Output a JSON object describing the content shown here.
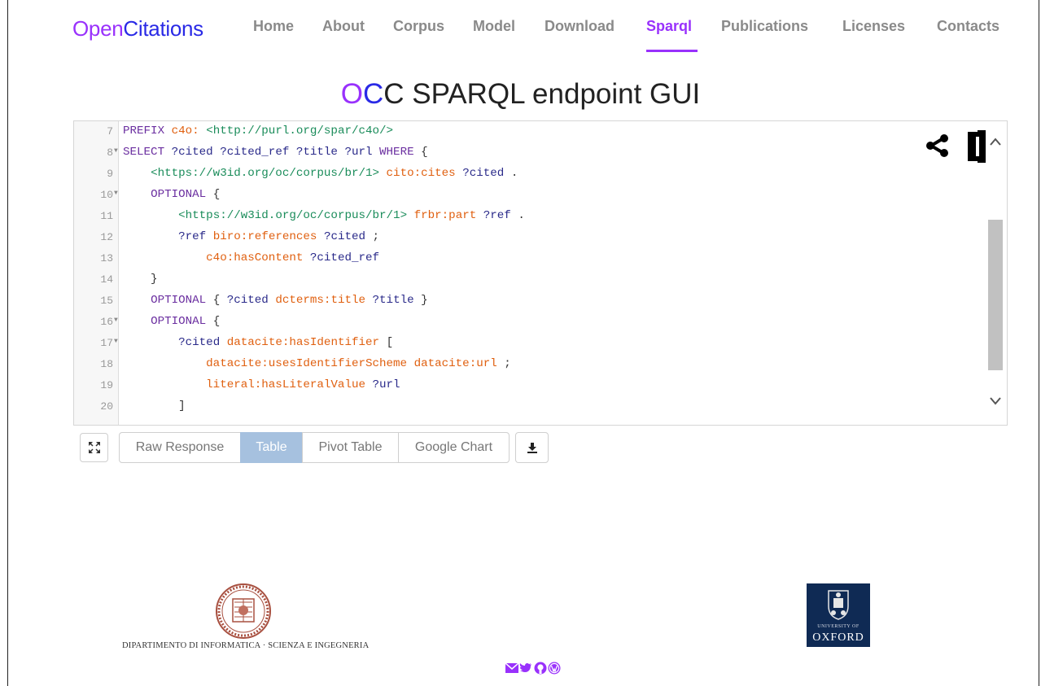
{
  "brand": {
    "part1": "Open",
    "part2": "Citations"
  },
  "nav": {
    "items": [
      {
        "label": "Home"
      },
      {
        "label": "About"
      },
      {
        "label": "Corpus"
      },
      {
        "label": "Model"
      },
      {
        "label": "Download"
      },
      {
        "label": "Sparql",
        "active": true
      },
      {
        "label": "Publications"
      },
      {
        "label": "Licenses"
      },
      {
        "label": "Contacts"
      }
    ]
  },
  "title": {
    "part1": "O",
    "part2": "C",
    "rest": "C SPARQL endpoint GUI"
  },
  "editor": {
    "lines": [
      {
        "n": "7",
        "fold": false,
        "tokens": [
          [
            "kw",
            "PREFIX "
          ],
          [
            "pfx",
            "c4o: "
          ],
          [
            "iri",
            "<http://purl.org/spar/c4o/>"
          ]
        ]
      },
      {
        "n": "8",
        "fold": true,
        "tokens": [
          [
            "kw",
            "SELECT "
          ],
          [
            "var",
            "?cited ?cited_ref ?title ?url "
          ],
          [
            "kw",
            "WHERE "
          ],
          [
            "pn",
            "{"
          ]
        ]
      },
      {
        "n": "9",
        "fold": false,
        "tokens": [
          [
            "pn",
            "    "
          ],
          [
            "iri",
            "<https://w3id.org/oc/corpus/br/1> "
          ],
          [
            "pfx",
            "cito:cites "
          ],
          [
            "var",
            "?cited "
          ],
          [
            "pn",
            "."
          ]
        ]
      },
      {
        "n": "10",
        "fold": true,
        "tokens": [
          [
            "pn",
            "    "
          ],
          [
            "kw",
            "OPTIONAL "
          ],
          [
            "pn",
            "{"
          ]
        ]
      },
      {
        "n": "11",
        "fold": false,
        "tokens": [
          [
            "pn",
            "        "
          ],
          [
            "iri",
            "<https://w3id.org/oc/corpus/br/1> "
          ],
          [
            "pfx",
            "frbr:part "
          ],
          [
            "var",
            "?ref "
          ],
          [
            "pn",
            "."
          ]
        ]
      },
      {
        "n": "12",
        "fold": false,
        "tokens": [
          [
            "pn",
            "        "
          ],
          [
            "var",
            "?ref "
          ],
          [
            "pfx",
            "biro:references "
          ],
          [
            "var",
            "?cited "
          ],
          [
            "pn",
            ";"
          ]
        ]
      },
      {
        "n": "13",
        "fold": false,
        "tokens": [
          [
            "pn",
            "            "
          ],
          [
            "pfx",
            "c4o:hasContent "
          ],
          [
            "var",
            "?cited_ref"
          ]
        ]
      },
      {
        "n": "14",
        "fold": false,
        "tokens": [
          [
            "pn",
            "    }"
          ]
        ]
      },
      {
        "n": "15",
        "fold": false,
        "tokens": [
          [
            "pn",
            "    "
          ],
          [
            "kw",
            "OPTIONAL "
          ],
          [
            "pn",
            "{ "
          ],
          [
            "var",
            "?cited "
          ],
          [
            "pfx",
            "dcterms:title "
          ],
          [
            "var",
            "?title "
          ],
          [
            "pn",
            "}"
          ]
        ]
      },
      {
        "n": "16",
        "fold": true,
        "tokens": [
          [
            "pn",
            "    "
          ],
          [
            "kw",
            "OPTIONAL "
          ],
          [
            "pn",
            "{"
          ]
        ]
      },
      {
        "n": "17",
        "fold": true,
        "tokens": [
          [
            "pn",
            "        "
          ],
          [
            "var",
            "?cited "
          ],
          [
            "pfx",
            "datacite:hasIdentifier "
          ],
          [
            "pn",
            "["
          ]
        ]
      },
      {
        "n": "18",
        "fold": false,
        "tokens": [
          [
            "pn",
            "            "
          ],
          [
            "pfx",
            "datacite:usesIdentifierScheme datacite:url "
          ],
          [
            "pn",
            ";"
          ]
        ]
      },
      {
        "n": "19",
        "fold": false,
        "tokens": [
          [
            "pn",
            "            "
          ],
          [
            "pfx",
            "literal:hasLiteralValue "
          ],
          [
            "var",
            "?url"
          ]
        ]
      },
      {
        "n": "20",
        "fold": false,
        "tokens": [
          [
            "pn",
            "        ]"
          ]
        ]
      }
    ]
  },
  "toolbar": {
    "tabs": [
      {
        "label": "Raw Response"
      },
      {
        "label": "Table",
        "active": true
      },
      {
        "label": "Pivot Table"
      },
      {
        "label": "Google Chart"
      }
    ]
  },
  "footer": {
    "unibo_text": "DIPARTIMENTO DI INFORMATICA · SCIENZA E INGEGNERIA",
    "oxford_small": "UNIVERSITY OF",
    "oxford_big": "OXFORD",
    "social_icons": [
      "envelope-icon",
      "twitter-icon",
      "github-icon",
      "wordpress-icon"
    ],
    "social_color": "#9931fc"
  }
}
